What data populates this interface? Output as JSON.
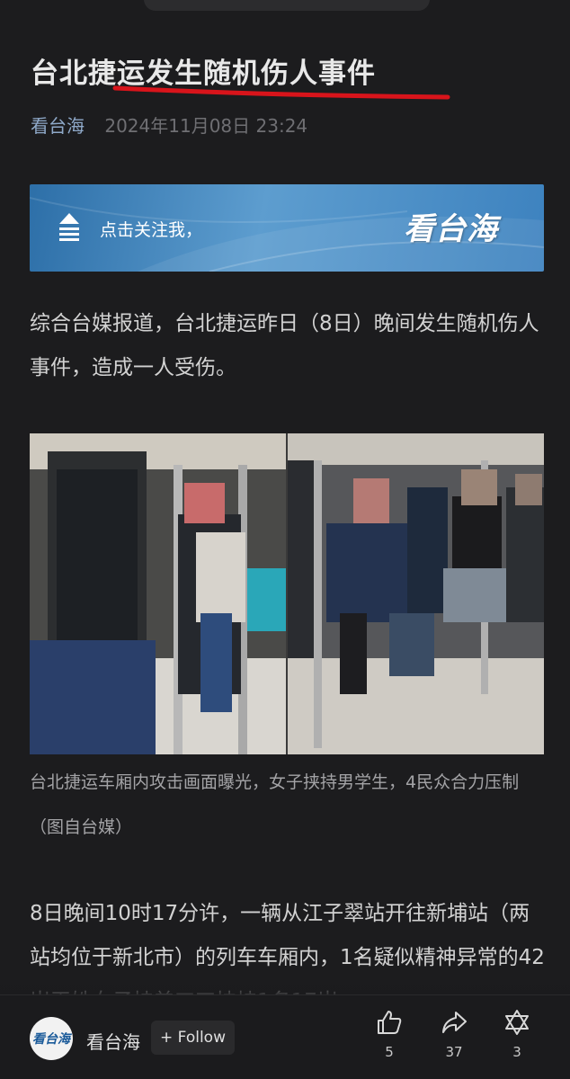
{
  "article": {
    "title": "台北捷运发生随机伤人事件",
    "source": "看台海",
    "datetime": "2024年11月08日  23:24",
    "banner_text": "点击关注我，",
    "banner_brand": "看台海",
    "paragraph1": "综合台媒报道，台北捷运昨日（8日）晚间发生随机伤人事件，造成一人受伤。",
    "caption": "台北捷运车厢内攻击画面曝光，女子挟持男学生，4民众合力压制（图自台媒）",
    "paragraph2": "8日晚间10时17分许，一辆从江子翠站开往新埔站（两站均位于新北市）的列车车厢内，1名疑似精神异常的42岁王姓女子持美工刀挟持1名17岁"
  },
  "bottom_bar": {
    "avatar_text": "看台海",
    "account_name": "看台海",
    "follow_label": "+ Follow",
    "like_count": "5",
    "share_count": "37",
    "third_count": "3"
  },
  "colors": {
    "underline": "#d8141b",
    "source": "#8fa9c9",
    "banner": "#4a8cc6"
  },
  "icons": [
    "upload-arrow-icon",
    "thumbs-up-icon",
    "share-arrow-icon",
    "star-of-david-icon"
  ]
}
